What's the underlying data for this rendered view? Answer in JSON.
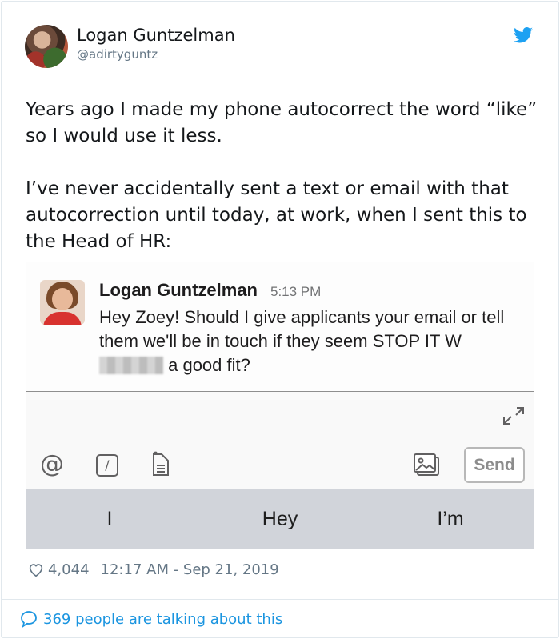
{
  "author": {
    "name": "Logan Guntzelman",
    "handle": "@adirtyguntz"
  },
  "tweet": {
    "text": "Years ago I made my phone autocorrect the word “like” so I would use it less.\n\nI’ve never accidentally sent a text or email with that autocorrection until today, at work, when I sent this to the Head of HR:"
  },
  "screenshot": {
    "sender": "Logan Guntzelman",
    "time": "5:13 PM",
    "message_part1": "Hey Zoey! Should I give applicants your email or tell them we'll be in touch if they seem STOP IT W",
    "message_part2": " a good fit?",
    "send_label": "Send",
    "suggestions": [
      "I",
      "Hey",
      "I’m"
    ],
    "icons": [
      "at-icon",
      "slash-command-icon",
      "file-icon",
      "photo-icon",
      "expand-icon"
    ]
  },
  "meta": {
    "likes": "4,044",
    "timestamp": "12:17 AM - Sep 21, 2019"
  },
  "footer": {
    "talking": "369 people are talking about this"
  },
  "colors": {
    "twitter_blue": "#1da1f2",
    "link_blue": "#1b95e0",
    "muted": "#657786"
  }
}
